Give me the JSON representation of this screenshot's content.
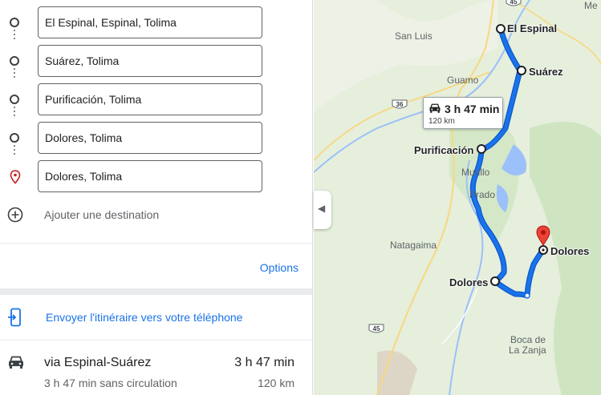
{
  "waypoints": [
    {
      "value": "El Espinal, Espinal, Tolima",
      "kind": "circle"
    },
    {
      "value": "Suárez, Tolima",
      "kind": "circle"
    },
    {
      "value": "Purificación, Tolima",
      "kind": "circle"
    },
    {
      "value": "Dolores, Tolima",
      "kind": "circle"
    },
    {
      "value": "Dolores, Tolima",
      "kind": "pin"
    }
  ],
  "add_destination_label": "Ajouter une destination",
  "options_label": "Options",
  "send_to_phone_label": "Envoyer l'itinéraire vers votre téléphone",
  "route": {
    "via": "via Espinal-Suárez",
    "duration": "3 h 47 min",
    "traffic_note": "3 h 47 min sans circulation",
    "distance": "120 km"
  },
  "map": {
    "route_card": {
      "duration": "3 h 47 min",
      "distance": "120 km"
    },
    "stops": {
      "espinal": "El Espinal",
      "suarez": "Suárez",
      "purificacion": "Purificación",
      "dolores_west": "Dolores",
      "dolores_east": "Dolores"
    },
    "places": {
      "me": "Me",
      "san_luis": "San Luis",
      "guamo": "Guamo",
      "murillo": "Murillo",
      "prado": "Prado",
      "natagaima": "Natagaima",
      "boca_de": "Boca de",
      "la_zanja": "La Zanja"
    },
    "shields": {
      "top": "45",
      "mid": "36",
      "bottom": "45"
    },
    "colors": {
      "route": "#1a73e8",
      "route_border": "#0b57d0",
      "pin": "#ea4335",
      "land": "#e3efd9",
      "water": "#9cc0f9",
      "road": "#f9d77f"
    }
  }
}
